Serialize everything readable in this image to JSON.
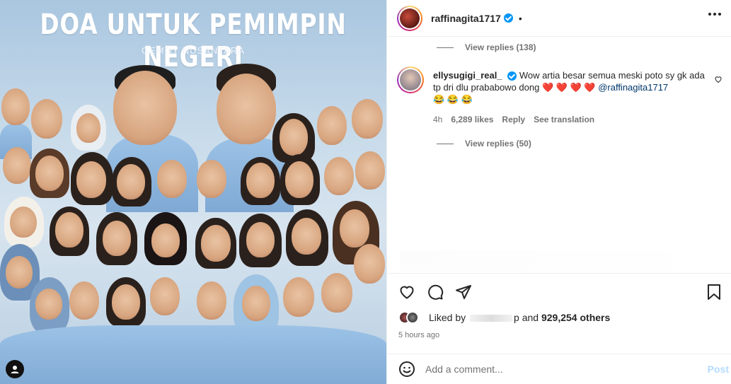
{
  "poster": {
    "title": "DOA UNTUK PEMIMPIN NEGERI",
    "subtitle": "GEMOY NUSANTARA"
  },
  "header": {
    "username": "raffinagita1717",
    "separator": "•"
  },
  "comments": {
    "view_replies_top": "View replies (138)",
    "comment": {
      "username": "ellysugigi_real_",
      "text": "Wow artia besar semua meski poto sy gk ada tp dri dlu prababowo dong",
      "hearts": "❤️ ❤️ ❤️ ❤️",
      "mention": "@raffinagita1717",
      "emojis": "😂 😂 😂",
      "age": "4h",
      "likes": "6,289 likes",
      "reply_label": "Reply",
      "translate_label": "See translation",
      "view_replies": "View replies (50)"
    }
  },
  "liked_by": {
    "prefix": "Liked by",
    "suffix_char": "p",
    "and_text": "and",
    "others": "929,254 others"
  },
  "timestamp": "5 hours ago",
  "add_comment": {
    "placeholder": "Add a comment...",
    "post_label": "Post"
  },
  "colors": {
    "verified": "#0095f6",
    "link": "#00376b",
    "muted": "#737373",
    "post_disabled": "#b3dbff"
  }
}
